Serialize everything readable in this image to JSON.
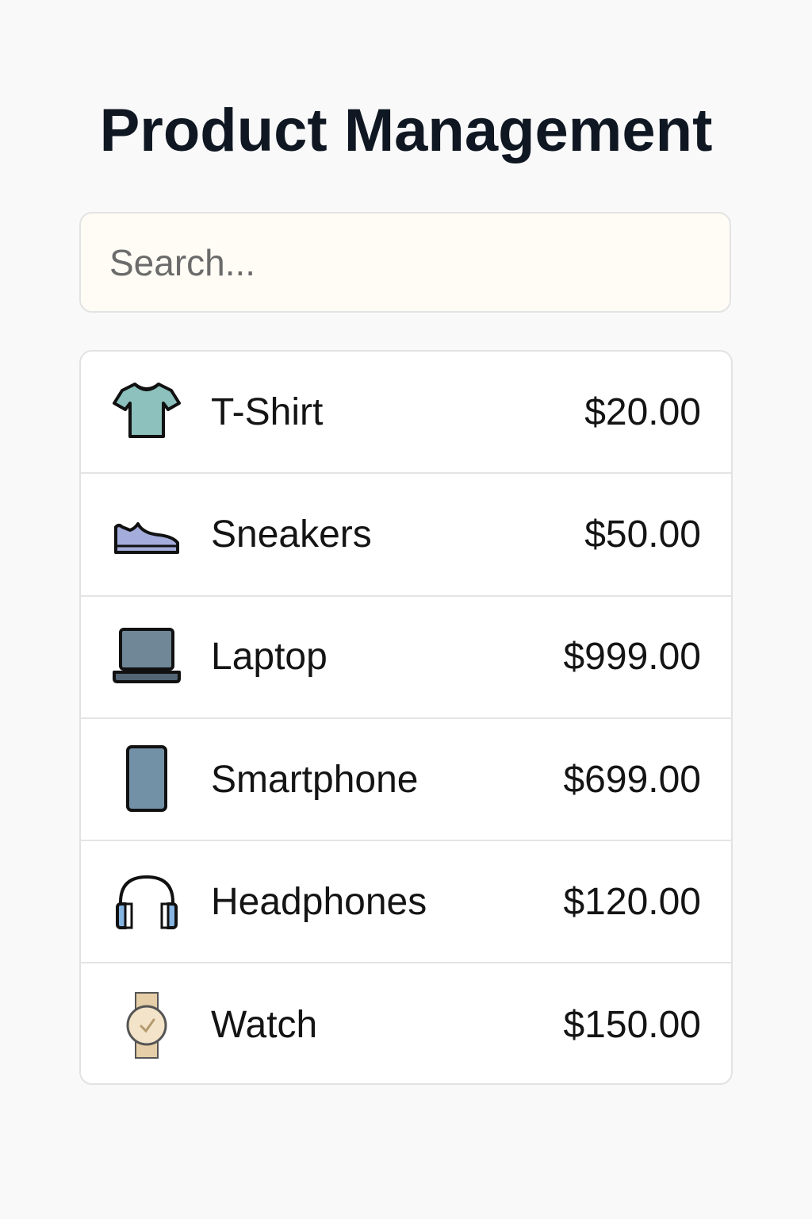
{
  "header": {
    "title": "Product Management"
  },
  "search": {
    "placeholder": "Search...",
    "value": ""
  },
  "products": [
    {
      "name": "T-Shirt",
      "price": "$20.00",
      "icon": "t-shirt-icon"
    },
    {
      "name": "Sneakers",
      "price": "$50.00",
      "icon": "sneakers-icon"
    },
    {
      "name": "Laptop",
      "price": "$999.00",
      "icon": "laptop-icon"
    },
    {
      "name": "Smartphone",
      "price": "$699.00",
      "icon": "smartphone-icon"
    },
    {
      "name": "Headphones",
      "price": "$120.00",
      "icon": "headphones-icon"
    },
    {
      "name": "Watch",
      "price": "$150.00",
      "icon": "watch-icon"
    }
  ],
  "colors": {
    "background": "#f9f9f9",
    "search_background": "#fffcf5",
    "tshirt": "#8dc1bd",
    "sneakers": "#a4acdc",
    "laptop": "#6f8796",
    "smartphone": "#7391a6",
    "headphones_cup": "#86b5e2",
    "watch_face": "#f3e3c8"
  }
}
